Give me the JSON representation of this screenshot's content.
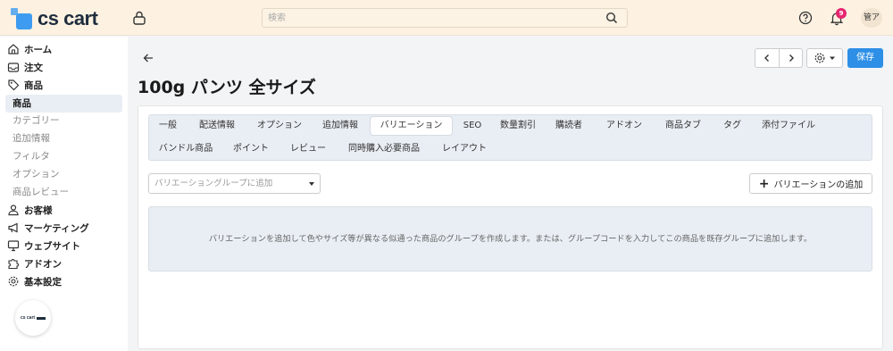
{
  "header": {
    "logo_text": "cs cart",
    "search_placeholder": "検索",
    "notification_count": "9",
    "avatar_text": "管ア"
  },
  "sidebar": {
    "items": [
      {
        "label": "ホーム",
        "icon": "home-icon"
      },
      {
        "label": "注文",
        "icon": "inbox-icon"
      },
      {
        "label": "商品",
        "icon": "tag-icon"
      }
    ],
    "active_sub": "商品",
    "subitems": [
      "カテゴリー",
      "追加情報",
      "フィルタ",
      "オプション",
      "商品レビュー"
    ],
    "items_after": [
      {
        "label": "お客様",
        "icon": "user-icon"
      },
      {
        "label": "マーケティング",
        "icon": "megaphone-icon"
      },
      {
        "label": "ウェブサイト",
        "icon": "monitor-icon"
      },
      {
        "label": "アドオン",
        "icon": "puzzle-icon"
      },
      {
        "label": "基本設定",
        "icon": "gear-icon"
      }
    ],
    "bubble_text": "cs cart"
  },
  "main": {
    "title": "100g パンツ 全サイズ",
    "save_label": "保存",
    "tabs": [
      "一般",
      "配送情報",
      "オプション",
      "追加情報",
      "バリエーション",
      "SEO",
      "数量割引",
      "購読者",
      "アドオン",
      "商品タブ",
      "タグ",
      "添付ファイル",
      "バンドル商品",
      "ポイント",
      "レビュー",
      "同時購入必要商品",
      "レイアウト"
    ],
    "active_tab": "バリエーション",
    "select_placeholder": "バリエーショングループに追加",
    "add_button_label": "バリエーションの追加",
    "empty_message": "バリエーションを追加して色やサイズ等が異なる似通った商品のグループを作成します。または、グループコードを入力してこの商品を既存グループに追加します。"
  },
  "colors": {
    "header_bg": "#fdf2e2",
    "accent": "#2d8fe6",
    "logo": "#3e9cf0",
    "badge": "#e5256f"
  }
}
